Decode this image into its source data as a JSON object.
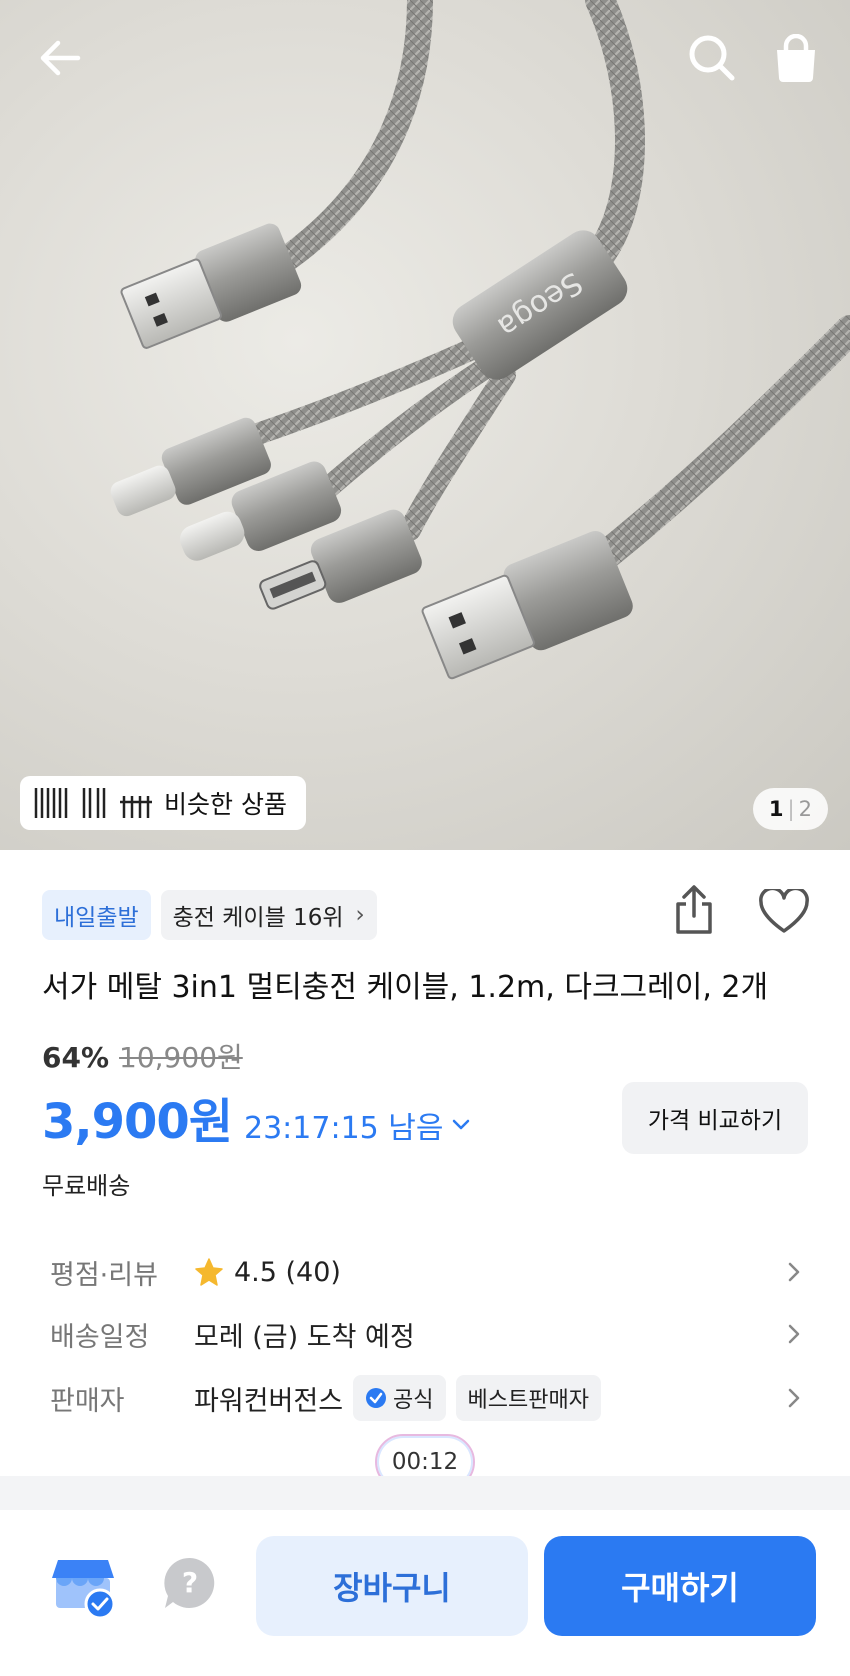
{
  "hero": {
    "brand_on_product": "Seoga",
    "similar_label": "비슷한 상품",
    "pager_current": "1",
    "pager_total": "2",
    "icons": [
      "back-arrow-icon",
      "search-icon",
      "shopping-bag-icon"
    ]
  },
  "badges": {
    "delivery": "내일출발",
    "rank": "충전 케이블 16위",
    "rank_chevron": "›"
  },
  "product": {
    "title": "서가 메탈 3in1 멀티충전 케이블, 1.2m, 다크그레이, 2개",
    "discount": "64%",
    "original_price": "10,900원",
    "price": "3,900원",
    "timer": "23:17:15 남음",
    "compare_label": "가격 비교하기",
    "shipping": "무료배송"
  },
  "details": {
    "rating_key": "평점·리뷰",
    "rating_value": "4.5 (40)",
    "delivery_key": "배송일정",
    "delivery_value": "모레 (금) 도착 예정",
    "seller_key": "판매자",
    "seller_name": "파워컨버전스",
    "seller_official": "공식",
    "seller_best": "베스트판매자"
  },
  "video_pill": "00:12",
  "bottom_bar": {
    "cart_label": "장바구니",
    "buy_label": "구매하기",
    "icons": [
      "store-icon",
      "help-question-icon"
    ]
  },
  "colors": {
    "accent": "#2b7af2",
    "accent_light": "#e7f0fd",
    "star": "#f5b82e"
  }
}
